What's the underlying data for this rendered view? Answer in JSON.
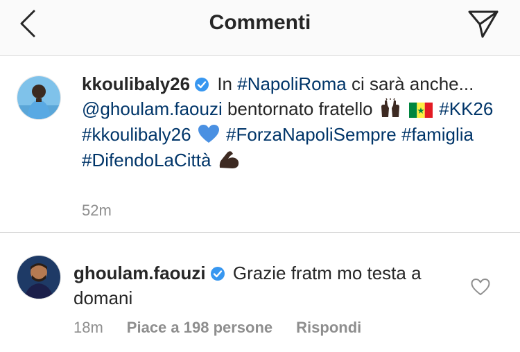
{
  "header": {
    "title": "Commenti",
    "back_icon": "chevron-left-icon",
    "send_icon": "paper-plane-icon"
  },
  "post": {
    "username": "kkoulibaly26",
    "verified": true,
    "text_1": "In",
    "tag_1": "#NapoliRoma",
    "text_2": "ci sarà anche...",
    "mention": "@ghoulam.faouzi",
    "text_3": "bentornato fratello",
    "tag_2": "#KK26",
    "tag_3": "#kkoulibaly26",
    "tag_4": "#ForzaNapoliSempre",
    "tag_5": "#famiglia",
    "tag_6": "#DifendoLaCittà",
    "time": "52m",
    "emojis": [
      "raising-hands",
      "senegal-flag",
      "blue-heart",
      "flexed-biceps"
    ]
  },
  "reply": {
    "username": "ghoulam.faouzi",
    "verified": true,
    "text": "Grazie fratm mo testa a domani",
    "time": "18m",
    "likes": "Piace a 198 persone",
    "reply_label": "Rispondi",
    "like_icon": "heart-outline-icon"
  },
  "colors": {
    "text": "#262626",
    "link": "#003569",
    "muted": "#8e8e8e",
    "verified": "#3897f0",
    "divider": "#dbdbdb",
    "header_bg": "#fafafa"
  }
}
